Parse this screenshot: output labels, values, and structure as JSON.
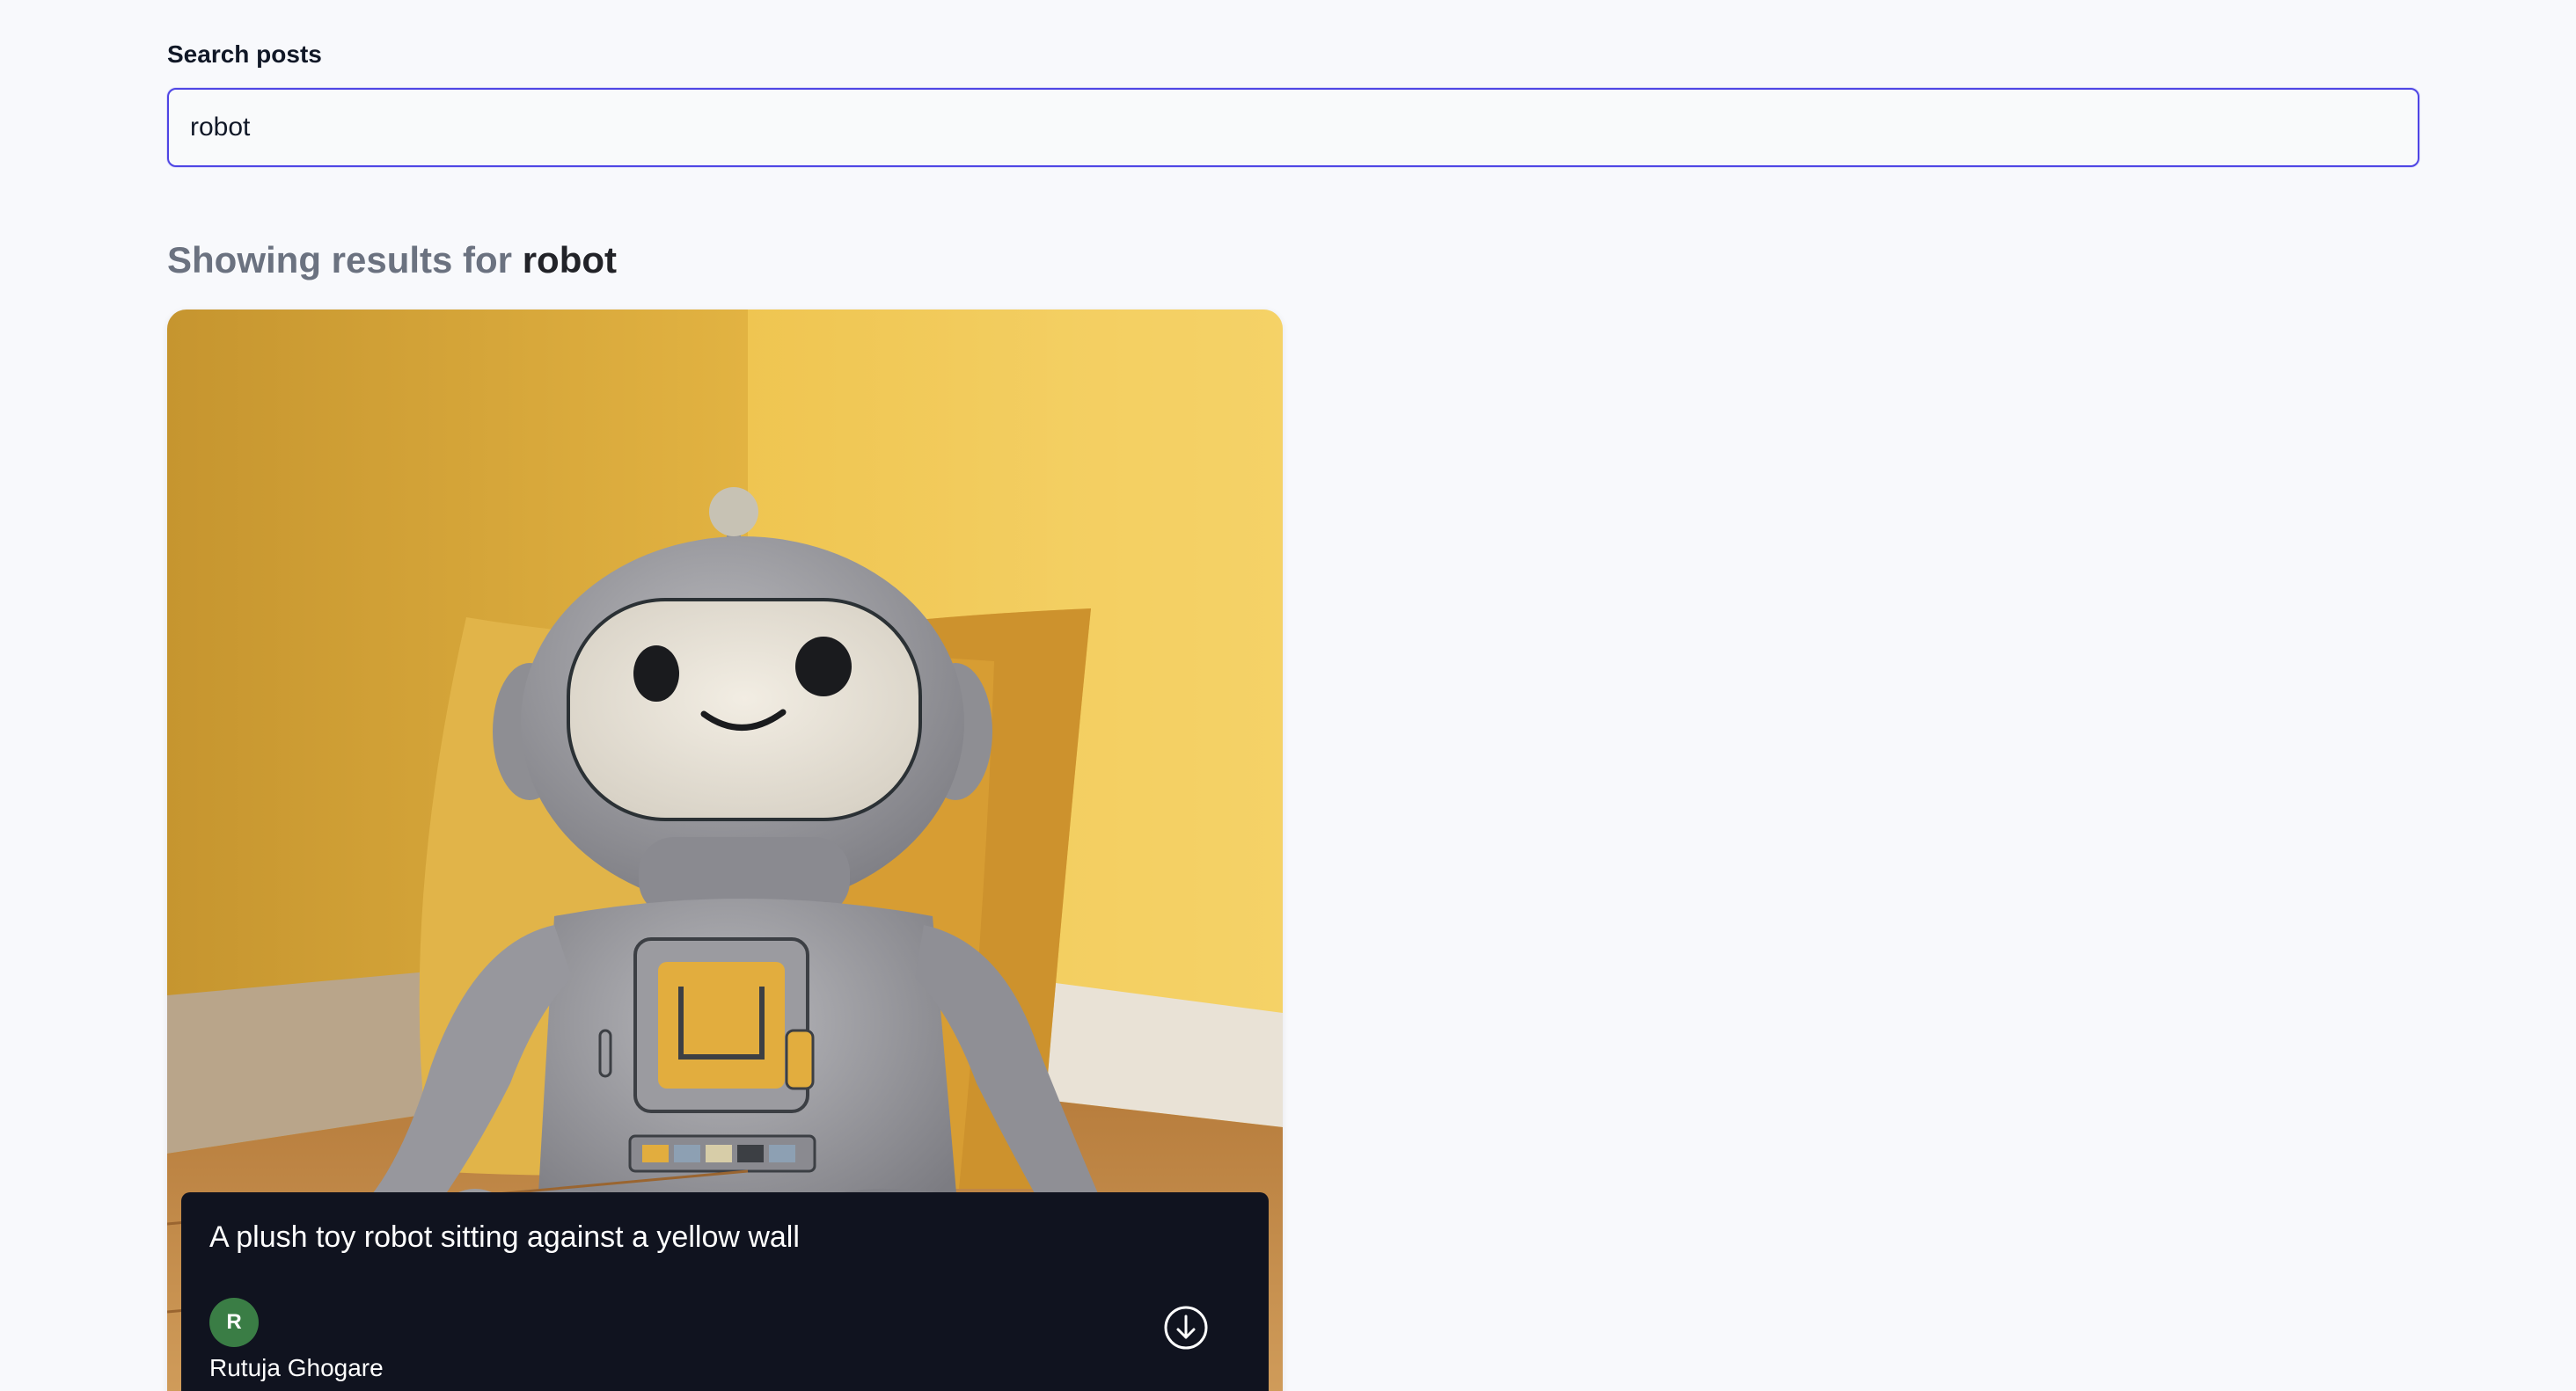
{
  "search": {
    "label": "Search posts",
    "value": "robot"
  },
  "results": {
    "prefix": "Showing results for",
    "term": "robot"
  },
  "posts": [
    {
      "caption": "A plush toy robot sitting against a yellow wall",
      "author_initial": "R",
      "author_name": "Rutuja Ghogare",
      "avatar_color": "#3a7d45",
      "download_icon": "download-icon"
    }
  ],
  "colors": {
    "accent": "#4f46e5",
    "overlay": "#10131f",
    "page_bg": "#f8f9fc"
  }
}
